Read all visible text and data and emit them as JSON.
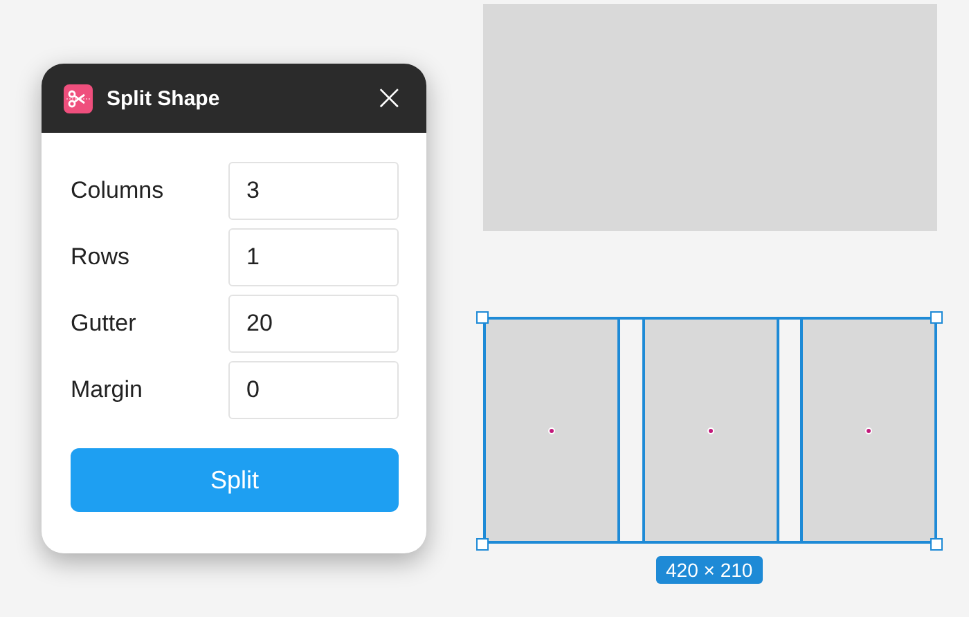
{
  "dialog": {
    "title": "Split Shape",
    "close": "×",
    "fields": [
      {
        "label": "Columns",
        "value": "3"
      },
      {
        "label": "Rows",
        "value": "1"
      },
      {
        "label": "Gutter",
        "value": "20"
      },
      {
        "label": "Margin",
        "value": "0"
      }
    ],
    "button": "Split"
  },
  "canvas": {
    "dimensions": "420 × 210"
  }
}
